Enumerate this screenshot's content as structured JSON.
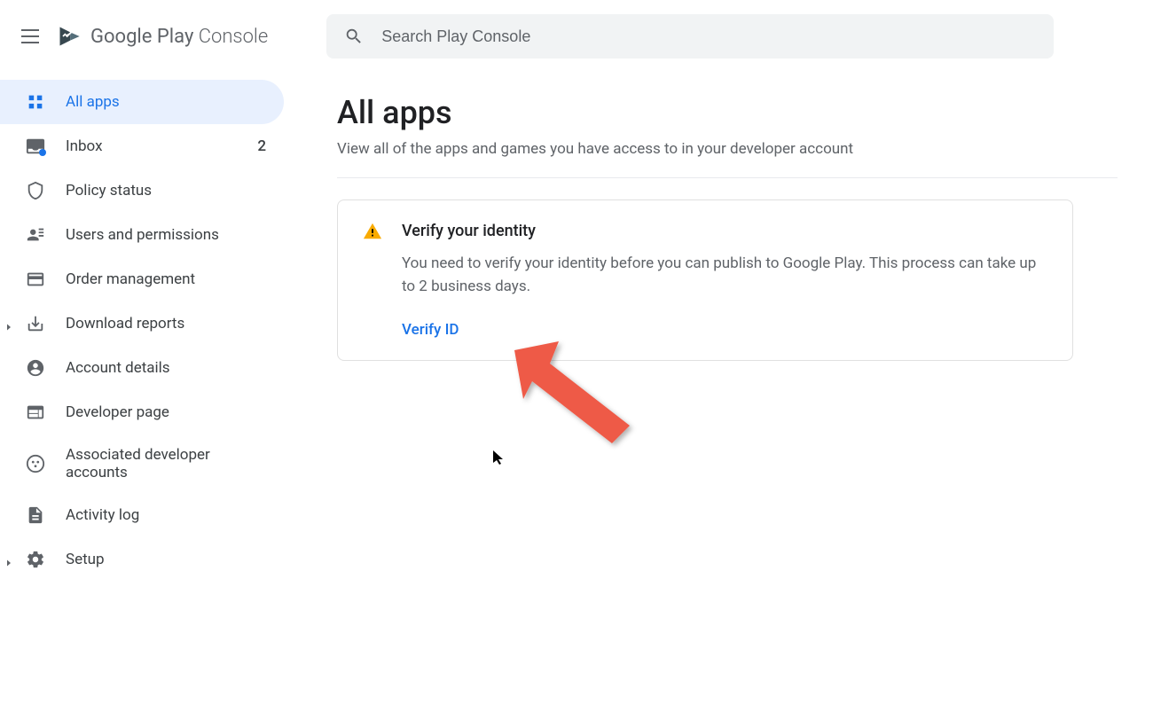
{
  "header": {
    "logo_primary": "Google Play",
    "logo_secondary": " Console"
  },
  "search": {
    "placeholder": "Search Play Console"
  },
  "sidebar": {
    "items": [
      {
        "label": "All apps"
      },
      {
        "label": "Inbox",
        "badge": "2"
      },
      {
        "label": "Policy status"
      },
      {
        "label": "Users and permissions"
      },
      {
        "label": "Order management"
      },
      {
        "label": "Download reports"
      },
      {
        "label": "Account details"
      },
      {
        "label": "Developer page"
      },
      {
        "label": "Associated developer accounts"
      },
      {
        "label": "Activity log"
      },
      {
        "label": "Setup"
      }
    ]
  },
  "main": {
    "title": "All apps",
    "subtitle": "View all of the apps and games you have access to in your developer account",
    "alert": {
      "title": "Verify your identity",
      "text": "You need to verify your identity before you can publish to Google Play. This process can take up to 2 business days.",
      "link": "Verify ID"
    }
  }
}
